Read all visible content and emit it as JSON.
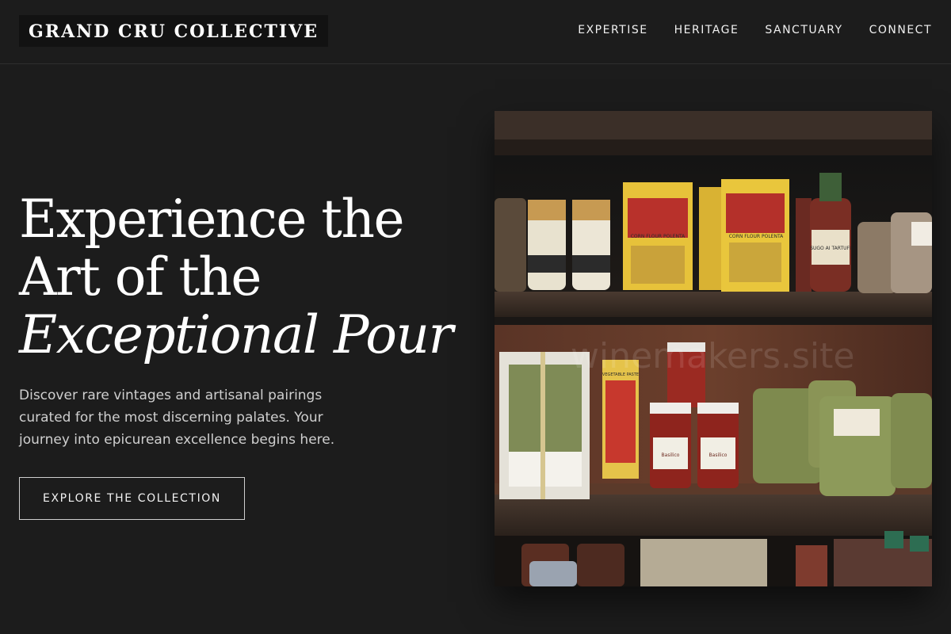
{
  "brand": {
    "name": "GRAND CRU COLLECTIVE"
  },
  "nav": {
    "items": [
      {
        "label": "EXPERTISE"
      },
      {
        "label": "HERITAGE"
      },
      {
        "label": "SANCTUARY"
      },
      {
        "label": "CONNECT"
      }
    ]
  },
  "hero": {
    "headline_line1": "Experience the",
    "headline_line2": "Art of the",
    "headline_line3": "Exceptional Pour",
    "subtitle": "Discover rare vintages and artisanal pairings curated for the most discerning palates. Your journey into epicurean excellence begins here.",
    "cta_label": "EXPLORE THE COLLECTION"
  },
  "image": {
    "watermark": "winemakers.site",
    "labels": {
      "polenta": "CORN FLOUR POLENTA",
      "sugo": "SUGO AI TARTUFI",
      "paste": "VEGETABLE PASTE",
      "basilico": "Basilico"
    }
  },
  "colors": {
    "background": "#1c1c1c",
    "brand_box": "#121212",
    "text_primary": "#ffffff",
    "text_secondary": "#cfcfcf"
  }
}
